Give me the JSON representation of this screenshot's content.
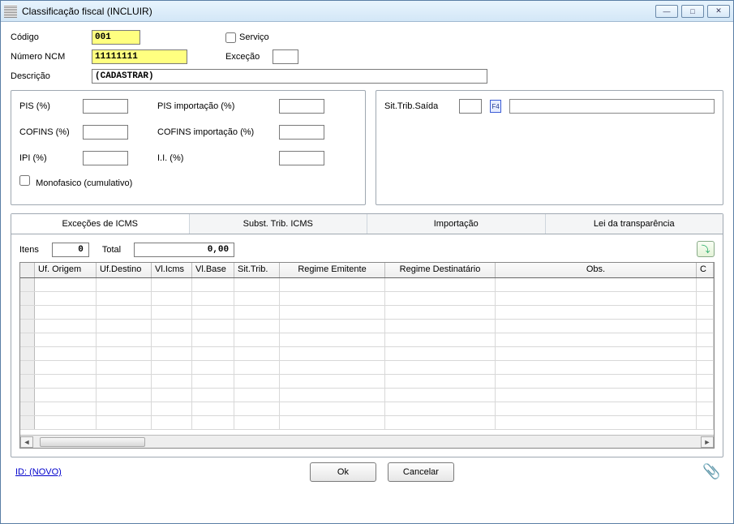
{
  "window": {
    "title": "Classificação fiscal (INCLUIR)"
  },
  "header": {
    "codigo_label": "Código",
    "codigo_value": "001",
    "servico_label": "Serviço",
    "ncm_label": "Número NCM",
    "ncm_value": "11111111",
    "excecao_label": "Exceção",
    "excecao_value": "",
    "descricao_label": "Descrição",
    "descricao_value": "(CADASTRAR)"
  },
  "taxes": {
    "pis_label": "PIS (%)",
    "pis_value": "",
    "pis_imp_label": "PIS importação (%)",
    "pis_imp_value": "",
    "cofins_label": "COFINS (%)",
    "cofins_value": "",
    "cofins_imp_label": "COFINS importação (%)",
    "cofins_imp_value": "",
    "ipi_label": "IPI (%)",
    "ipi_value": "",
    "ii_label": "I.I. (%)",
    "ii_value": "",
    "monofasico_label": "Monofasico (cumulativo)"
  },
  "sit": {
    "label": "Sit.Trib.Saída",
    "code": "",
    "lookup_hint": "F4",
    "desc": ""
  },
  "tabs": {
    "t1": "Exceções de ICMS",
    "t2": "Subst. Trib. ICMS",
    "t3": "Importação",
    "t4": "Lei da transparência"
  },
  "items": {
    "itens_label": "Itens",
    "itens_value": "0",
    "total_label": "Total",
    "total_value": "0,00"
  },
  "grid": {
    "columns": {
      "rowhead": "",
      "uf_origem": "Uf. Origem",
      "uf_destino": "Uf.Destino",
      "vl_icms": "Vl.Icms",
      "vl_base": "Vl.Base",
      "sit_trib": "Sit.Trib.",
      "regime_emit": "Regime Emitente",
      "regime_dest": "Regime Destinatário",
      "obs": "Obs.",
      "last": "C"
    }
  },
  "footer": {
    "id_label": "ID: (NOVO)",
    "ok": "Ok",
    "cancelar": "Cancelar"
  },
  "icons": {
    "minimize": "—",
    "maximize": "□",
    "close": "✕",
    "attach": "📎",
    "grid_action": "⤵",
    "arrow_left": "◄",
    "arrow_right": "►"
  }
}
